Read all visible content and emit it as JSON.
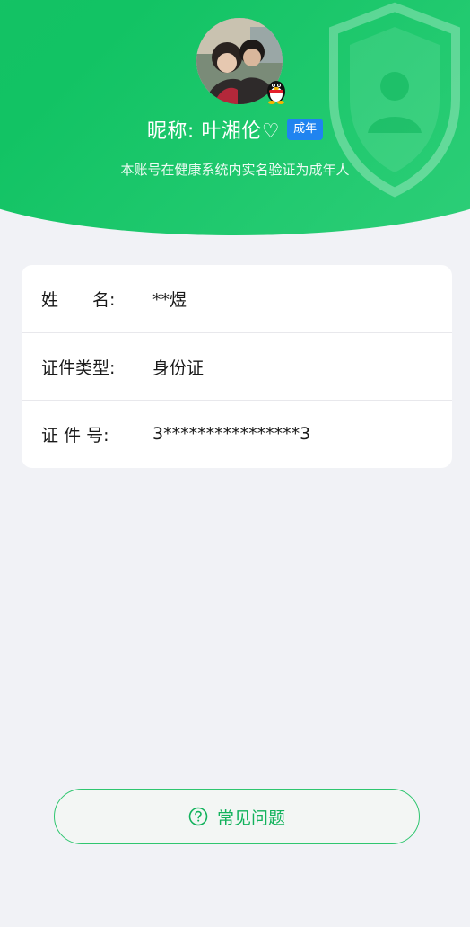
{
  "header": {
    "nickname": "昵称: 叶湘伦♡",
    "age_badge": "成年",
    "verify_text": "本账号在健康系统内实名验证为成年人"
  },
  "info": {
    "rows": [
      {
        "label": "姓　　名:",
        "value": "**煜"
      },
      {
        "label": "证件类型:",
        "value": "身份证"
      },
      {
        "label": "证 件 号:",
        "value": "3****************3"
      }
    ]
  },
  "faq": {
    "label": "常见问题"
  },
  "colors": {
    "brand_green": "#17c066",
    "badge_blue": "#1f84f0",
    "background": "#f1f2f6"
  }
}
